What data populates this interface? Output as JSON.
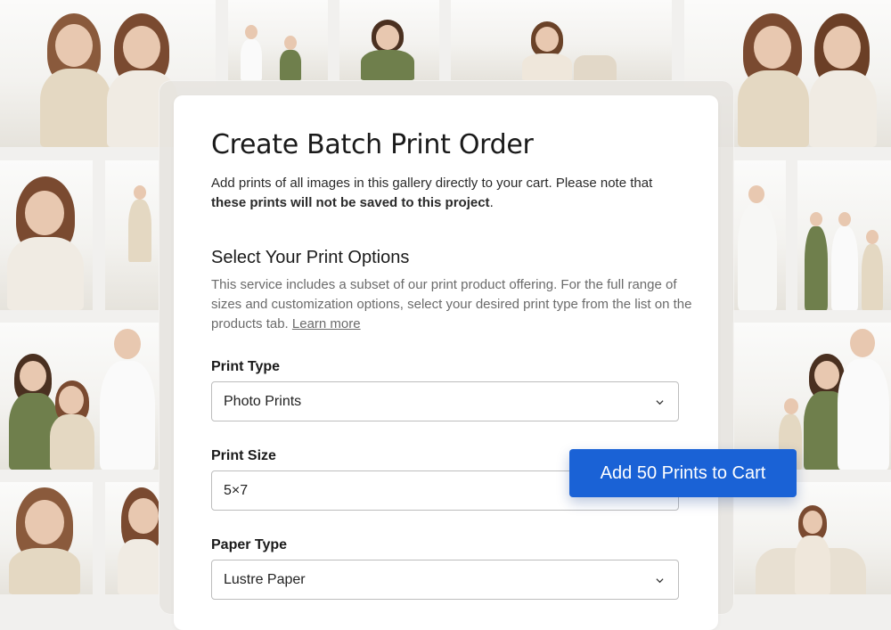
{
  "dialog": {
    "title": "Create Batch Print Order",
    "intro_text": "Add prints of all images in this gallery directly to your cart. Please note that ",
    "intro_bold": "these prints will not be saved to this project",
    "intro_end": "."
  },
  "options": {
    "section_title": "Select Your Print Options",
    "description": "This service includes a subset of our print product offering. For the full range of sizes and customization options, select your desired print type from the list on the products tab. ",
    "learn_more": "Learn more"
  },
  "fields": {
    "print_type": {
      "label": "Print Type",
      "value": "Photo Prints"
    },
    "print_size": {
      "label": "Print Size",
      "value": "5×7"
    },
    "paper_type": {
      "label": "Paper Type",
      "value": "Lustre Paper"
    }
  },
  "cta": {
    "label": "Add 50 Prints to Cart",
    "color": "#1a62d6"
  },
  "icons": {
    "dropdown": "chevron-down-icon"
  }
}
